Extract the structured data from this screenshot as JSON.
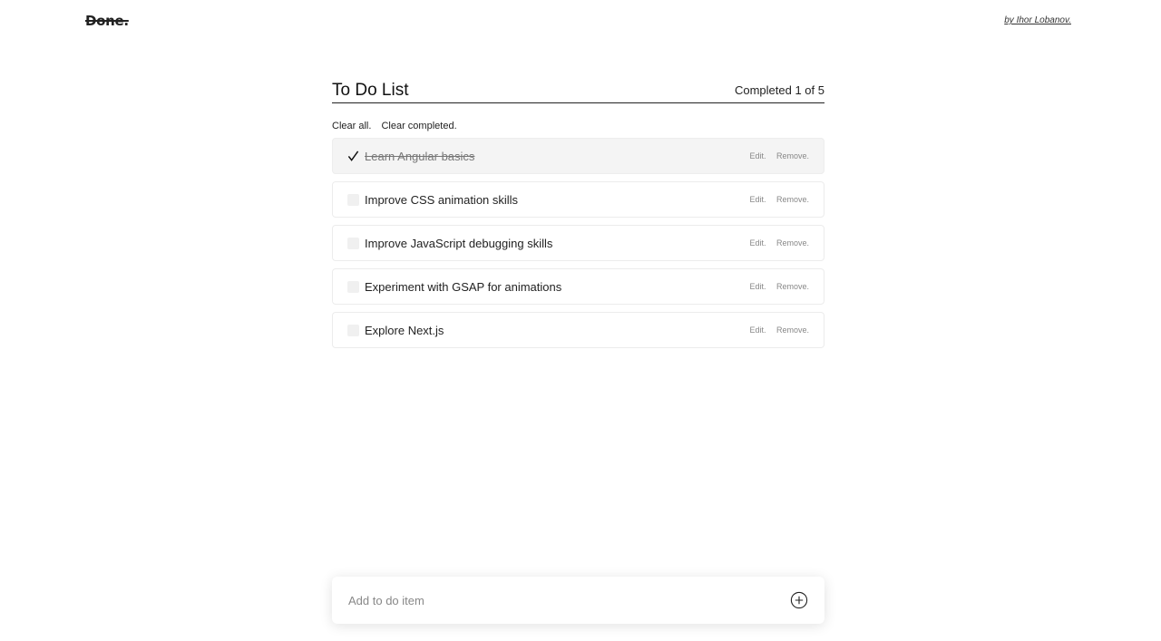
{
  "header": {
    "logo": "Done.",
    "author": "by Ihor Lobanov."
  },
  "todo": {
    "title": "To Do List",
    "completed_status": "Completed 1 of 5",
    "clear_all": "Clear all.",
    "clear_completed": "Clear completed.",
    "items": [
      {
        "text": "Learn Angular basics",
        "done": true,
        "edit": "Edit.",
        "remove": "Remove."
      },
      {
        "text": "Improve CSS animation skills",
        "done": false,
        "edit": "Edit.",
        "remove": "Remove."
      },
      {
        "text": "Improve JavaScript debugging skills",
        "done": false,
        "edit": "Edit.",
        "remove": "Remove."
      },
      {
        "text": "Experiment with GSAP for animations",
        "done": false,
        "edit": "Edit.",
        "remove": "Remove."
      },
      {
        "text": "Explore Next.js",
        "done": false,
        "edit": "Edit.",
        "remove": "Remove."
      }
    ]
  },
  "add_item": {
    "placeholder": "Add to do item",
    "value": "",
    "icon": "plus-circle-icon"
  }
}
